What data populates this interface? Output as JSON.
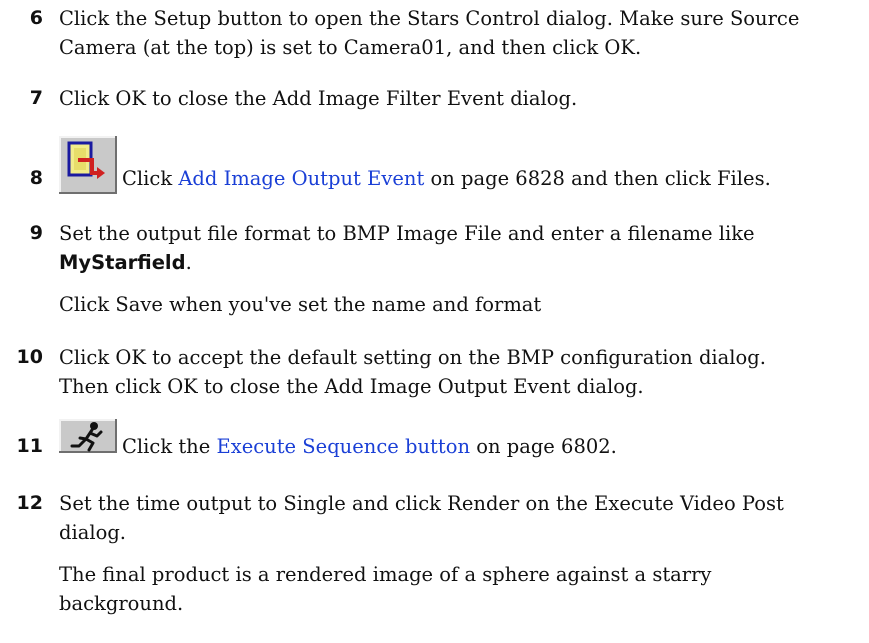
{
  "steps": [
    {
      "number": "6",
      "line1": "Click the Setup button to open the Stars Control dialog. Make sure Source",
      "line2": "Camera (at the top) is set to Camera01, and then click OK."
    },
    {
      "number": "7",
      "text": "Click OK to close the Add Image Filter Event dialog."
    },
    {
      "number": "8",
      "icon": "add-image-output-event-icon",
      "pre": "Click ",
      "link": "Add Image Output Event",
      "post": " on page 6828 and then click Files."
    },
    {
      "number": "9",
      "line1": "Set the output file format to BMP Image File and enter a filename like",
      "bold": "MyStarfield",
      "bold_after": ".",
      "note": "Click Save when you've set the name and format"
    },
    {
      "number": "10",
      "line1": "Click OK to accept the default setting on the BMP configuration dialog.",
      "line2": "Then click OK to close the Add Image Output Event dialog."
    },
    {
      "number": "11",
      "icon": "execute-sequence-running-man-icon",
      "pre": "Click the ",
      "link": "Execute Sequence button",
      "post": " on page 6802."
    },
    {
      "number": "12",
      "line1": "Set the time output to Single and click Render on the Execute Video Post",
      "line2": "dialog.",
      "note_line1": "The final product is a rendered image of a sphere against a starry",
      "note_line2": "background."
    }
  ],
  "colors": {
    "link": "#1a3fd6",
    "text": "#111111",
    "icon_button": "#c9c9c9"
  }
}
